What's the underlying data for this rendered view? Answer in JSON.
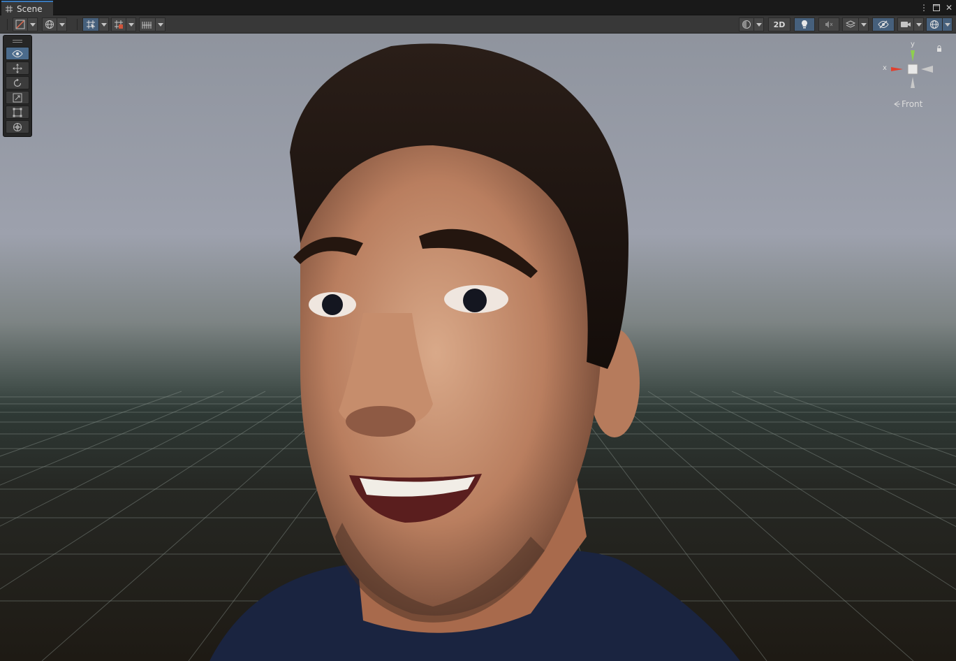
{
  "window": {
    "tab_title": "Scene",
    "tab_icon": "grid-hash-icon",
    "controls": {
      "more": "⋮",
      "maximize": "□",
      "close": "✕"
    }
  },
  "toolbar": {
    "left": [
      {
        "name": "draw-mode-button",
        "icon": "shaded-draw-mode-icon"
      },
      {
        "name": "render-globe-button",
        "icon": "globe-icon"
      },
      {
        "name": "grid-snap-toggle",
        "icon": "grid-snap-icon",
        "active": true
      },
      {
        "name": "grid-visibility-button",
        "icon": "grid-plane-icon"
      },
      {
        "name": "increment-snap-button",
        "icon": "ruler-snap-icon"
      }
    ],
    "right": {
      "shading_icon": "sphere-shading-icon",
      "mode_2d_label": "2D",
      "lighting_icon": "lightbulb-icon",
      "audio_icon": "audio-mute-icon",
      "effects_icon": "layers-effects-icon",
      "hidden_objects_icon": "eye-slash-icon",
      "camera_icon": "camera-icon",
      "gizmos_icon": "gizmo-globe-icon"
    }
  },
  "tool_palette": {
    "tools": [
      {
        "name": "view-tool",
        "icon": "eye-icon",
        "active": true
      },
      {
        "name": "move-tool",
        "icon": "move-arrows-icon"
      },
      {
        "name": "rotate-tool",
        "icon": "rotate-icon"
      },
      {
        "name": "scale-tool",
        "icon": "scale-icon"
      },
      {
        "name": "rect-tool",
        "icon": "rect-transform-icon"
      },
      {
        "name": "transform-tool",
        "icon": "transform-globe-icon"
      }
    ]
  },
  "gizmo": {
    "y_label": "y",
    "x_label": "x",
    "view_label": "Front",
    "lock_icon": "lock-icon",
    "colors": {
      "x": "#e0402f",
      "y": "#8ed04c",
      "neutral": "#c9c9c9"
    }
  },
  "scene": {
    "content": "3D character head model",
    "colors": {
      "sky_top": "#8c929c",
      "horizon": "#3a4642",
      "ground": "#2a2620",
      "grid": "#7e8882"
    }
  }
}
